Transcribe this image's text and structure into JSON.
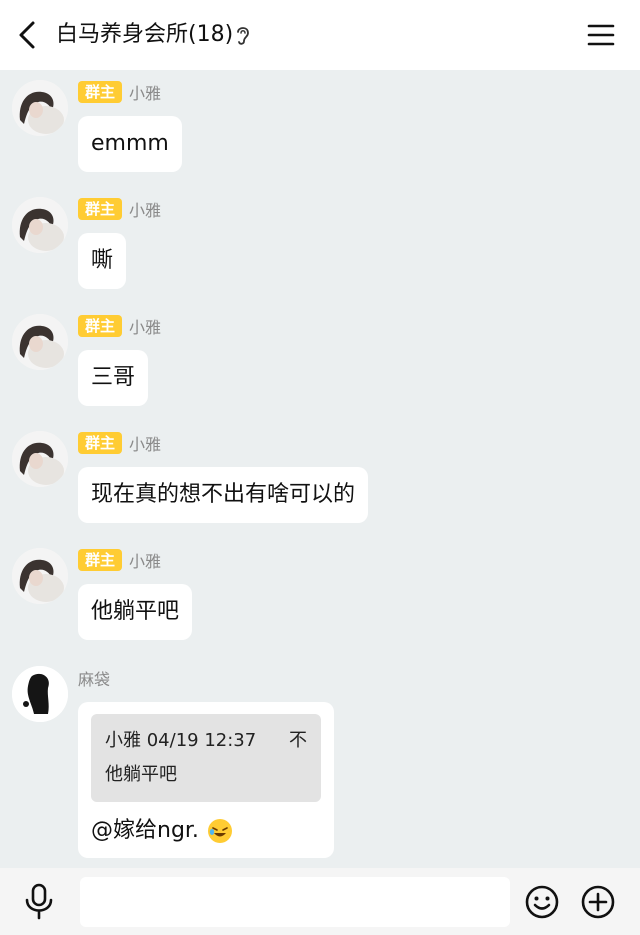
{
  "header": {
    "title": "白马养身会所(18)",
    "back_icon": "chevron-left-icon",
    "ear_icon": "ear-icon",
    "menu_icon": "menu-icon"
  },
  "messages": [
    {
      "badge": "群主",
      "sender": "小雅",
      "text": "emmm"
    },
    {
      "badge": "群主",
      "sender": "小雅",
      "text": "嘶"
    },
    {
      "badge": "群主",
      "sender": "小雅",
      "text": "三哥"
    },
    {
      "badge": "群主",
      "sender": "小雅",
      "text": "现在真的想不出有啥可以的"
    },
    {
      "badge": "群主",
      "sender": "小雅",
      "text": "他躺平吧"
    }
  ],
  "reply_message": {
    "sender": "麻袋",
    "quote_header": "小雅 04/19 12:37",
    "quote_text": "他躺平吧",
    "quote_pin": "不",
    "text": "@嫁给ngr.",
    "emoji_icon": "laughing-emoji-icon"
  },
  "input_bar": {
    "placeholder": "",
    "mic_icon": "microphone-icon",
    "emoji_icon": "smile-icon",
    "plus_icon": "plus-circle-icon"
  },
  "colors": {
    "badge": "#ffcc33",
    "background": "#ebeff0",
    "bubble": "#ffffff"
  }
}
